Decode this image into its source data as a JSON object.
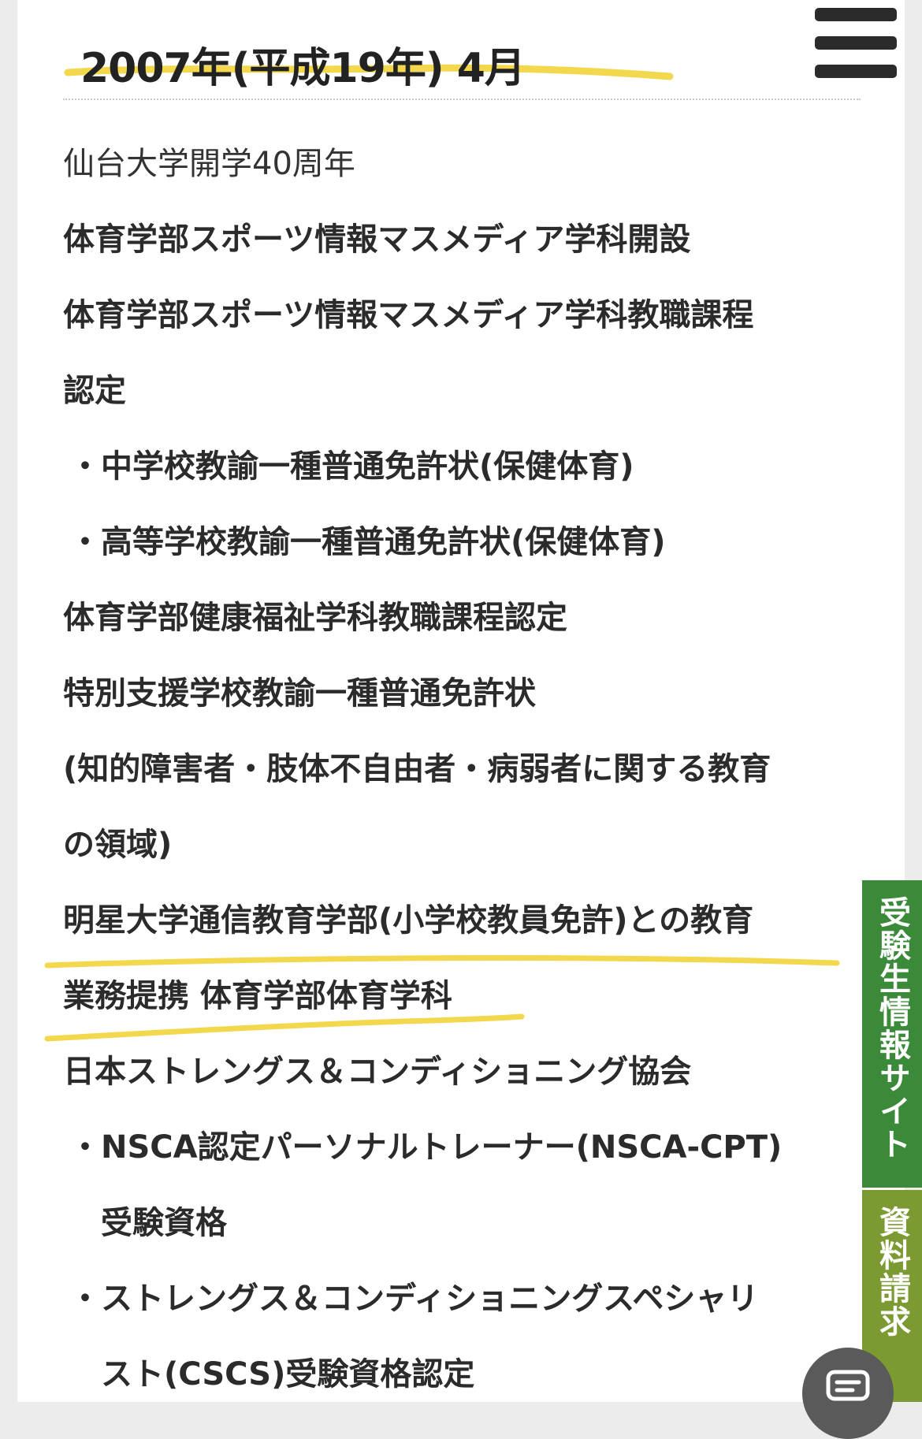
{
  "header": {
    "title": "2007年(平成19年) 4月"
  },
  "menu": {
    "icon": "hamburger-menu-icon"
  },
  "lines": [
    {
      "text": "仙台大学開学40周年",
      "style": "reg"
    },
    {
      "text": "体育学部スポーツ情報マスメディア学科開設",
      "style": "bold"
    },
    {
      "text": "体育学部スポーツ情報マスメディア学科教職課程",
      "style": "bold"
    },
    {
      "text": "認定",
      "style": "bold"
    },
    {
      "text": "・中学校教諭一種普通免許状(保健体育)",
      "style": "bullet"
    },
    {
      "text": "・高等学校教諭一種普通免許状(保健体育)",
      "style": "bullet"
    },
    {
      "text": "体育学部健康福祉学科教職課程認定",
      "style": "bold"
    },
    {
      "text": "特別支援学校教諭一種普通免許状",
      "style": "bold"
    },
    {
      "text": "(知的障害者・肢体不自由者・病弱者に関する教育",
      "style": "bold"
    },
    {
      "text": "の領域)",
      "style": "bold"
    },
    {
      "text": "明星大学通信教育学部(小学校教員免許)との教育",
      "style": "bold"
    },
    {
      "text": "業務提携 体育学部体育学科",
      "style": "bold"
    },
    {
      "text": "日本ストレングス＆コンディショニング協会",
      "style": "bold"
    },
    {
      "text": "・NSCA認定パーソナルトレーナー(NSCA-CPT)",
      "style": "bullet"
    },
    {
      "text": "受験資格",
      "style": "indent"
    },
    {
      "text": "・ストレングス＆コンディショニングスペシャリ",
      "style": "bullet"
    },
    {
      "text": "スト(CSCS)受験資格認定",
      "style": "indent"
    }
  ],
  "side_tabs": {
    "exam": "受験生情報サイト",
    "request": "資料請求"
  },
  "fab": {
    "icon": "chat-icon"
  },
  "colors": {
    "highlight": "#f2d43a",
    "tab_green": "#3a8a3a",
    "tab_olive": "#7b9a32"
  }
}
